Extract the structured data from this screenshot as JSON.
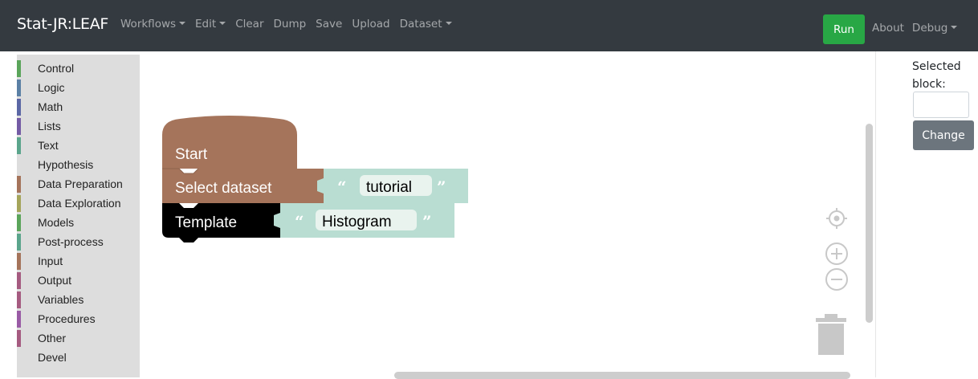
{
  "navbar": {
    "brand": "Stat-JR:LEAF",
    "menu": [
      {
        "label": "Workflows",
        "dropdown": true
      },
      {
        "label": "Edit",
        "dropdown": true
      },
      {
        "label": "Clear",
        "dropdown": false
      },
      {
        "label": "Dump",
        "dropdown": false
      },
      {
        "label": "Save",
        "dropdown": false
      },
      {
        "label": "Upload",
        "dropdown": false
      },
      {
        "label": "Dataset",
        "dropdown": true
      }
    ],
    "run_label": "Run",
    "about_label": "About",
    "debug_label": "Debug"
  },
  "toolbox": {
    "categories": [
      {
        "label": "Control",
        "color": "#5ba55b"
      },
      {
        "label": "Logic",
        "color": "#5b80a5"
      },
      {
        "label": "Math",
        "color": "#5b67a5"
      },
      {
        "label": "Lists",
        "color": "#745ba5"
      },
      {
        "label": "Text",
        "color": "#5ba58c"
      },
      {
        "label": "Hypothesis",
        "color": ""
      },
      {
        "label": "Data Preparation",
        "color": "#a5745b"
      },
      {
        "label": "Data Exploration",
        "color": "#a5a55b"
      },
      {
        "label": "Models",
        "color": "#5ba55b"
      },
      {
        "label": "Post-process",
        "color": "#5ba58c"
      },
      {
        "label": "Input",
        "color": "#a5745b"
      },
      {
        "label": "Output",
        "color": "#a55b80"
      },
      {
        "label": "Variables",
        "color": "#a55b80"
      },
      {
        "label": "Procedures",
        "color": "#995ba5"
      },
      {
        "label": "Other",
        "color": "#a55b80"
      },
      {
        "label": "Devel",
        "color": ""
      }
    ]
  },
  "workspace": {
    "blocks": {
      "start_label": "Start",
      "select_label": "Select dataset",
      "select_value": "tutorial",
      "template_label": "Template",
      "template_value": "Histogram"
    },
    "colors": {
      "start": "#a5745b",
      "select": "#a5745b",
      "template": "#000000",
      "string": "#b9ddd2",
      "string_field": "#e9f3ee"
    },
    "controls": [
      "target-icon",
      "zoom-in-icon",
      "zoom-out-icon",
      "trash-icon"
    ]
  },
  "right_panel": {
    "selected_label": "Selected block:",
    "input_value": "",
    "change_label": "Change"
  }
}
